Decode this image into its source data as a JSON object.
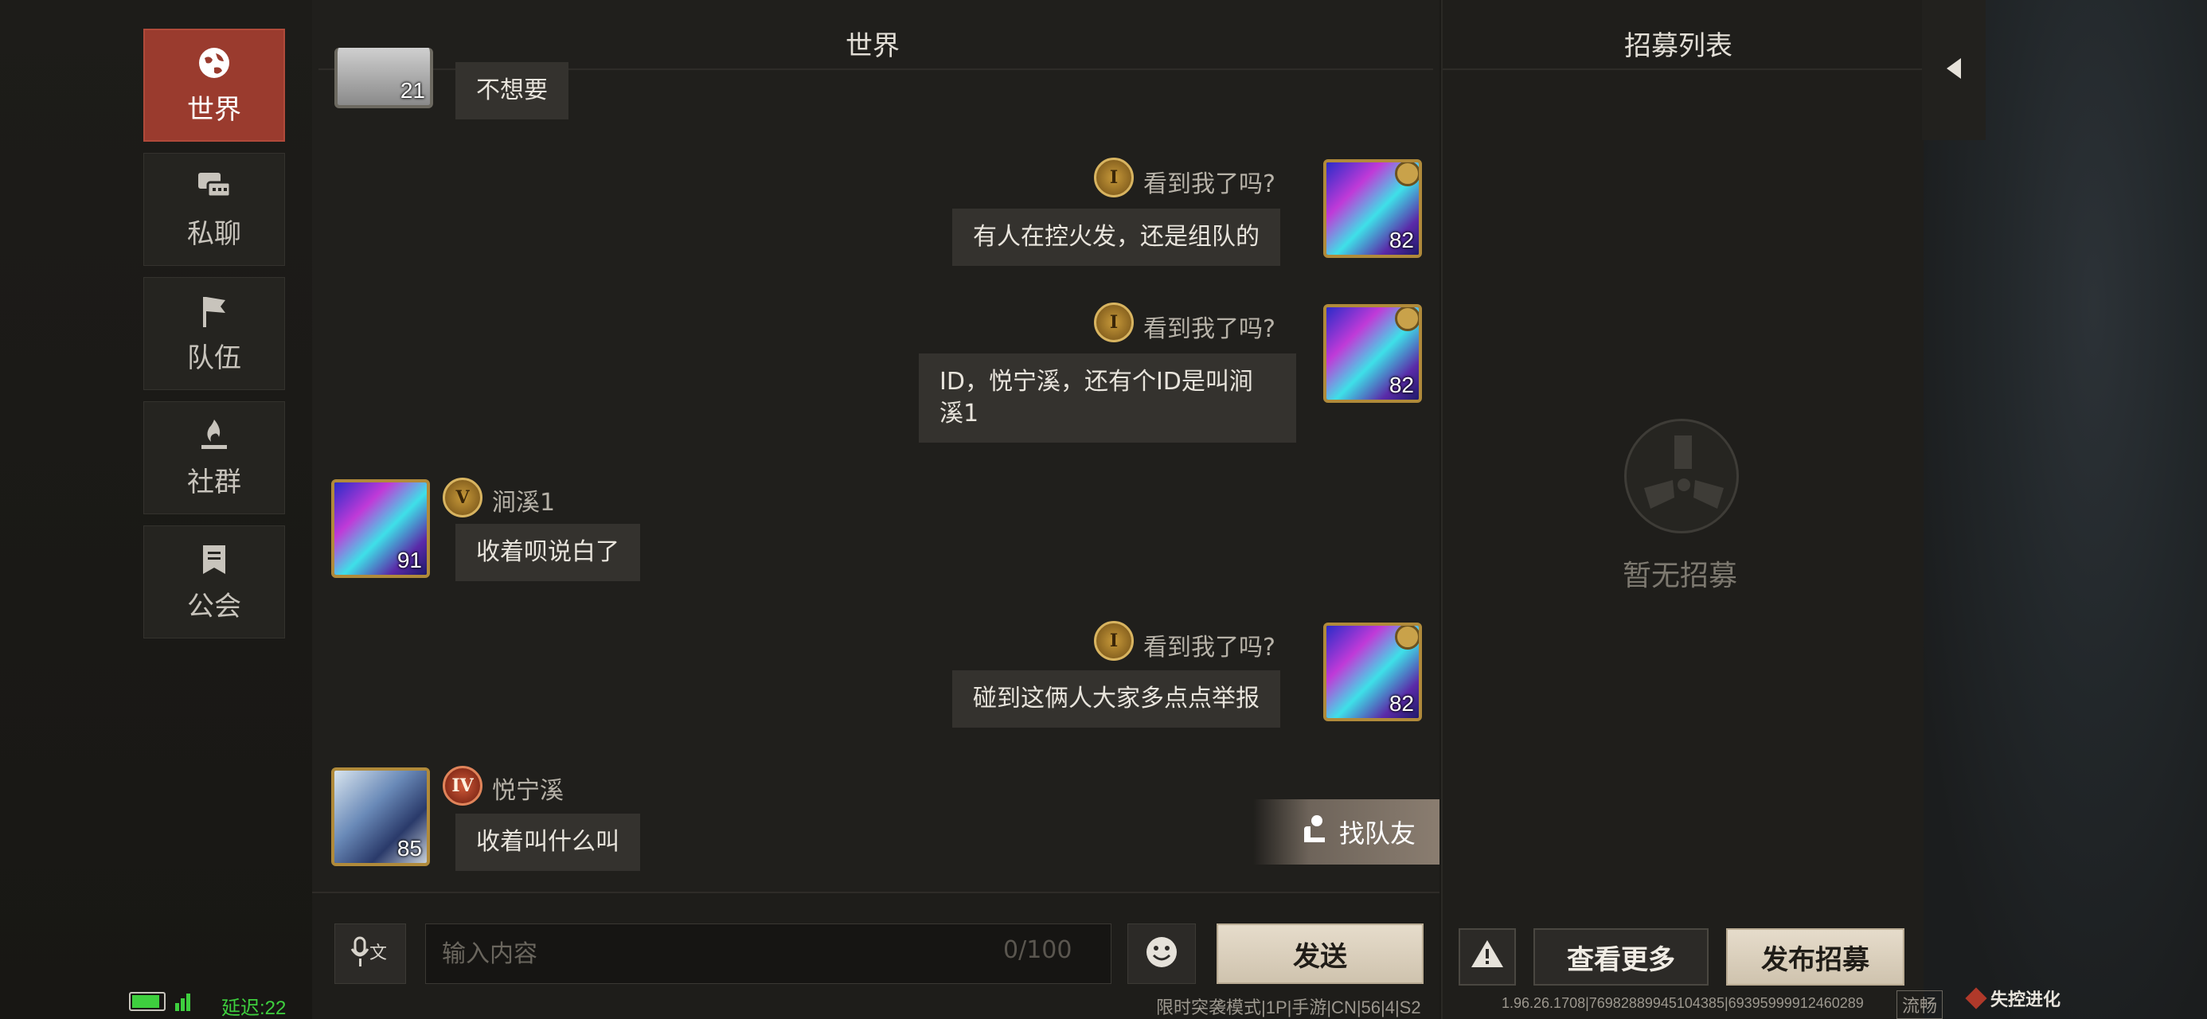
{
  "sidebar": {
    "tabs": [
      {
        "label": "世界",
        "icon": "globe-icon",
        "active": true
      },
      {
        "label": "私聊",
        "icon": "chat-bubbles-icon",
        "active": false
      },
      {
        "label": "队伍",
        "icon": "flag-icon",
        "active": false
      },
      {
        "label": "社群",
        "icon": "campfire-icon",
        "active": false
      },
      {
        "label": "公会",
        "icon": "banner-icon",
        "active": false
      }
    ]
  },
  "chat": {
    "title": "世界",
    "messages": [
      {
        "side": "left",
        "name": "",
        "level": "21",
        "text": "不想要"
      },
      {
        "side": "right",
        "name": "看到我了吗?",
        "rank": "I",
        "level": "82",
        "text": "有人在控火发，还是组队的"
      },
      {
        "side": "right",
        "name": "看到我了吗?",
        "rank": "I",
        "level": "82",
        "text_line1": "ID，悦宁溪，还有个ID是叫涧",
        "text_line2": "溪1"
      },
      {
        "side": "left",
        "name": "涧溪1",
        "rank": "V",
        "level": "91",
        "text": "收着呗说白了"
      },
      {
        "side": "right",
        "name": "看到我了吗?",
        "rank": "I",
        "level": "82",
        "text": "碰到这俩人大家多点点举报"
      },
      {
        "side": "left",
        "name": "悦宁溪",
        "rank": "IV",
        "level": "85",
        "text": "收着叫什么叫"
      }
    ],
    "find_team_label": "找队友",
    "input_placeholder": "输入内容",
    "counter": "0/100",
    "send_label": "发送"
  },
  "recruit": {
    "title": "招募列表",
    "empty_text": "暂无招募",
    "warning_icon": "warning-icon",
    "view_more_label": "查看更多",
    "post_label": "发布招募"
  },
  "status_bar": {
    "latency": "延迟:22",
    "mode": "限时突袭模式|1P|手游|CN|56|4|S2",
    "version": "1.96.26.1708|76982889945104385|69395999912460289",
    "quality": "流畅",
    "logo_text": "失控进化"
  },
  "colors": {
    "active_tab": "#9a3b2e",
    "accent_gold": "#b08a3a",
    "parchment": "#e6dccb",
    "battery_green": "#3ecf3e"
  }
}
